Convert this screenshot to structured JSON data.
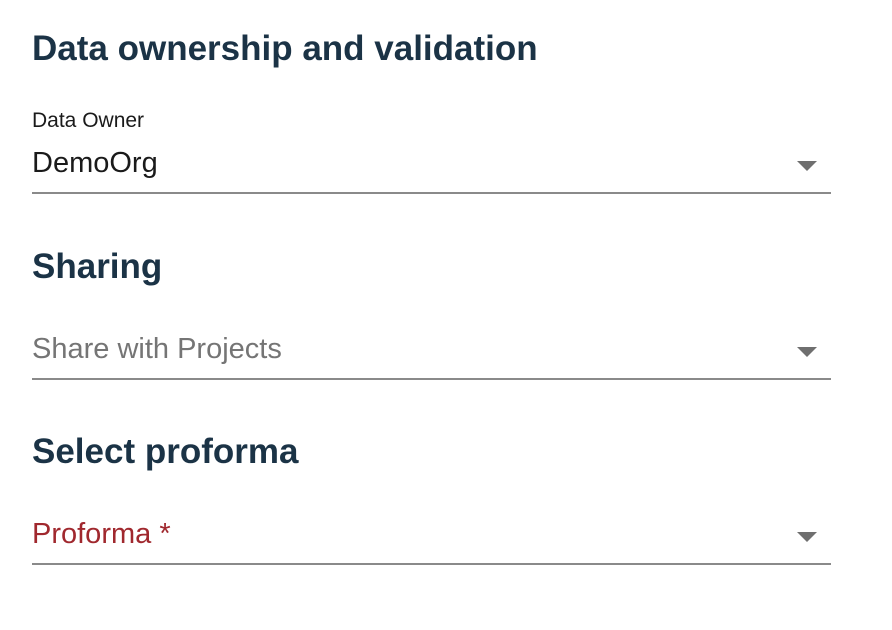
{
  "sections": {
    "ownership": {
      "title": "Data ownership and validation",
      "owner_label": "Data Owner",
      "owner_value": "DemoOrg"
    },
    "sharing": {
      "title": "Sharing",
      "placeholder": "Share with Projects"
    },
    "proforma": {
      "title": "Select proforma",
      "placeholder": "Proforma *"
    }
  },
  "colors": {
    "heading": "#1b3346",
    "required_label": "#a0282e",
    "placeholder": "#757575",
    "underline": "#8a8a8a"
  },
  "icons": {
    "dropdown": "chevron-down-icon"
  }
}
